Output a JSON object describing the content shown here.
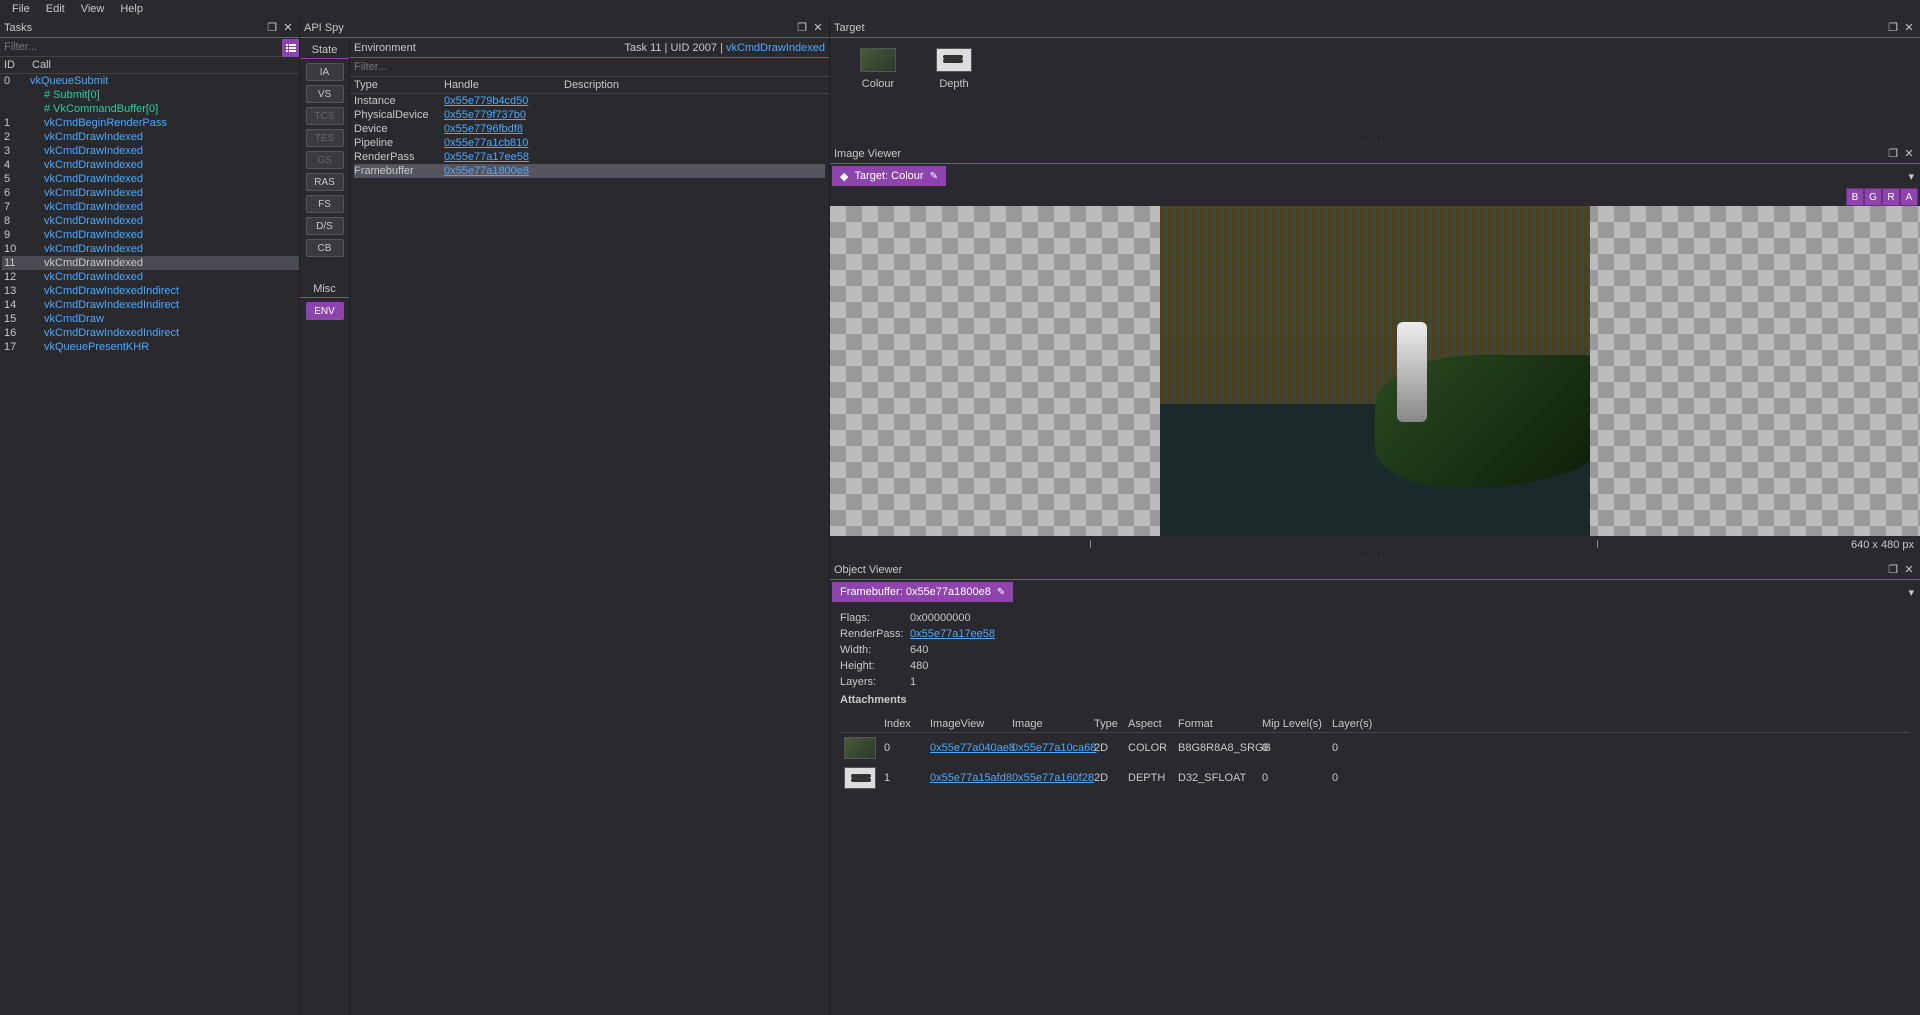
{
  "menu": {
    "file": "File",
    "edit": "Edit",
    "view": "View",
    "help": "Help"
  },
  "tasks": {
    "title": "Tasks",
    "filter_placeholder": "Filter...",
    "col_id": "ID",
    "col_call": "Call",
    "rows": [
      {
        "id": "0",
        "label": "vkQueueSubmit",
        "cls": "link-blue",
        "indent": 0
      },
      {
        "id": "",
        "label": "# Submit[0]",
        "cls": "link-teal",
        "indent": 1
      },
      {
        "id": "",
        "label": "# VkCommandBuffer[0]",
        "cls": "link-teal",
        "indent": 1
      },
      {
        "id": "1",
        "label": "vkCmdBeginRenderPass",
        "cls": "link-blue",
        "indent": 1
      },
      {
        "id": "2",
        "label": "vkCmdDrawIndexed",
        "cls": "link-blue",
        "indent": 1
      },
      {
        "id": "3",
        "label": "vkCmdDrawIndexed",
        "cls": "link-blue",
        "indent": 1
      },
      {
        "id": "4",
        "label": "vkCmdDrawIndexed",
        "cls": "link-blue",
        "indent": 1
      },
      {
        "id": "5",
        "label": "vkCmdDrawIndexed",
        "cls": "link-blue",
        "indent": 1
      },
      {
        "id": "6",
        "label": "vkCmdDrawIndexed",
        "cls": "link-blue",
        "indent": 1
      },
      {
        "id": "7",
        "label": "vkCmdDrawIndexed",
        "cls": "link-blue",
        "indent": 1
      },
      {
        "id": "8",
        "label": "vkCmdDrawIndexed",
        "cls": "link-blue",
        "indent": 1
      },
      {
        "id": "9",
        "label": "vkCmdDrawIndexed",
        "cls": "link-blue",
        "indent": 1
      },
      {
        "id": "10",
        "label": "vkCmdDrawIndexed",
        "cls": "link-blue",
        "indent": 1
      },
      {
        "id": "11",
        "label": "vkCmdDrawIndexed",
        "cls": "",
        "indent": 1,
        "selected": true
      },
      {
        "id": "12",
        "label": "vkCmdDrawIndexed",
        "cls": "link-blue",
        "indent": 1
      },
      {
        "id": "13",
        "label": "vkCmdDrawIndexedIndirect",
        "cls": "link-blue",
        "indent": 1
      },
      {
        "id": "14",
        "label": "vkCmdDrawIndexedIndirect",
        "cls": "link-blue",
        "indent": 1
      },
      {
        "id": "15",
        "label": "vkCmdDraw",
        "cls": "link-blue",
        "indent": 1
      },
      {
        "id": "16",
        "label": "vkCmdDrawIndexedIndirect",
        "cls": "link-blue",
        "indent": 1
      },
      {
        "id": "17",
        "label": "vkQueuePresentKHR",
        "cls": "link-blue",
        "indent": 1
      }
    ]
  },
  "apispy": {
    "title": "API Spy",
    "state_label": "State",
    "stages": [
      {
        "label": "IA",
        "cls": ""
      },
      {
        "label": "VS",
        "cls": ""
      },
      {
        "label": "TCS",
        "cls": "disabled"
      },
      {
        "label": "TES",
        "cls": "disabled"
      },
      {
        "label": "GS",
        "cls": "disabled"
      },
      {
        "label": "RAS",
        "cls": ""
      },
      {
        "label": "FS",
        "cls": ""
      },
      {
        "label": "D/S",
        "cls": ""
      },
      {
        "label": "CB",
        "cls": ""
      }
    ],
    "misc_label": "Misc",
    "env_btn": "ENV",
    "env_title": "Environment",
    "crumb_task": "Task 11",
    "crumb_uid": "UID 2007",
    "crumb_cmd": "vkCmdDrawIndexed",
    "filter_placeholder": "Filter...",
    "head_type": "Type",
    "head_handle": "Handle",
    "head_desc": "Description",
    "rows": [
      {
        "type": "Instance",
        "handle": "0x55e779b4cd50"
      },
      {
        "type": "PhysicalDevice",
        "handle": "0x55e779f737b0"
      },
      {
        "type": "Device",
        "handle": "0x55e7796fbdf8"
      },
      {
        "type": "Pipeline",
        "handle": "0x55e77a1cb810"
      },
      {
        "type": "RenderPass",
        "handle": "0x55e77a17ee58"
      },
      {
        "type": "Framebuffer",
        "handle": "0x55e77a1800e8",
        "hilite": true
      }
    ]
  },
  "target": {
    "title": "Target",
    "items": [
      {
        "name": "Colour",
        "kind": "color"
      },
      {
        "name": "Depth",
        "kind": "depth"
      }
    ]
  },
  "imgviewer": {
    "title": "Image Viewer",
    "tag": "Target: Colour",
    "channels": [
      "B",
      "G",
      "R",
      "A"
    ],
    "dimensions": "640 x 480 px"
  },
  "objviewer": {
    "title": "Object Viewer",
    "tag": "Framebuffer: 0x55e77a1800e8",
    "fields": {
      "flags_k": "Flags:",
      "flags_v": "0x00000000",
      "rp_k": "RenderPass:",
      "rp_v": "0x55e77a17ee58",
      "w_k": "Width:",
      "w_v": "640",
      "h_k": "Height:",
      "h_v": "480",
      "lay_k": "Layers:",
      "lay_v": "1"
    },
    "attach_label": "Attachments",
    "cols": {
      "index": "Index",
      "iv": "ImageView",
      "img": "Image",
      "type": "Type",
      "aspect": "Aspect",
      "format": "Format",
      "mip": "Mip Level(s)",
      "layer": "Layer(s)"
    },
    "rows": [
      {
        "index": "0",
        "iv": "0x55e77a040ae8",
        "img": "0x55e77a10ca68",
        "type": "2D",
        "aspect": "COLOR",
        "format": "B8G8R8A8_SRGB",
        "mip": "0",
        "layer": "0",
        "kind": "color"
      },
      {
        "index": "1",
        "iv": "0x55e77a15afd8",
        "img": "0x55e77a160f28",
        "type": "2D",
        "aspect": "DEPTH",
        "format": "D32_SFLOAT",
        "mip": "0",
        "layer": "0",
        "kind": "depth"
      }
    ]
  }
}
